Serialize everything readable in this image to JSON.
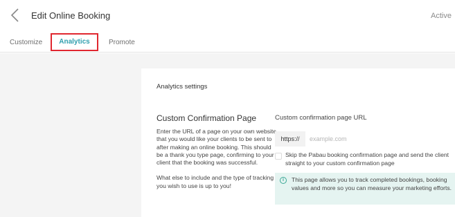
{
  "header": {
    "title": "Edit Online Booking",
    "status": "Active"
  },
  "tabs": [
    {
      "label": "Customize",
      "active": false
    },
    {
      "label": "Analytics",
      "active": true
    },
    {
      "label": "Promote",
      "active": false
    }
  ],
  "main": {
    "section_heading": "Analytics settings",
    "card_title": "Custom Confirmation Page",
    "description_1": "Enter the URL of a page on your own website that you would like your clients to be sent to after making an online booking. This should be a thank you type page, confirming to your client that the booking was successful.",
    "description_2": "What else to include and the type of tracking you wish to use is up to you!",
    "url_label": "Custom confirmation page URL",
    "url_prefix": "https://",
    "url_placeholder": "example.com",
    "url_value": "",
    "skip_label": "Skip the Pabau booking confirmation page and send the client straight to your custom confirmation page",
    "skip_checked": false,
    "info_text": "This page allows you to track completed bookings, booking values and more so you can measure your marketing efforts."
  },
  "colors": {
    "accent": "#2f9fae",
    "highlight_border": "#e0262f",
    "info_bg": "#e5f4f1",
    "page_bg": "#f4f4f4"
  },
  "icons": {
    "back": "chevron-left-icon",
    "info": "info-icon"
  }
}
